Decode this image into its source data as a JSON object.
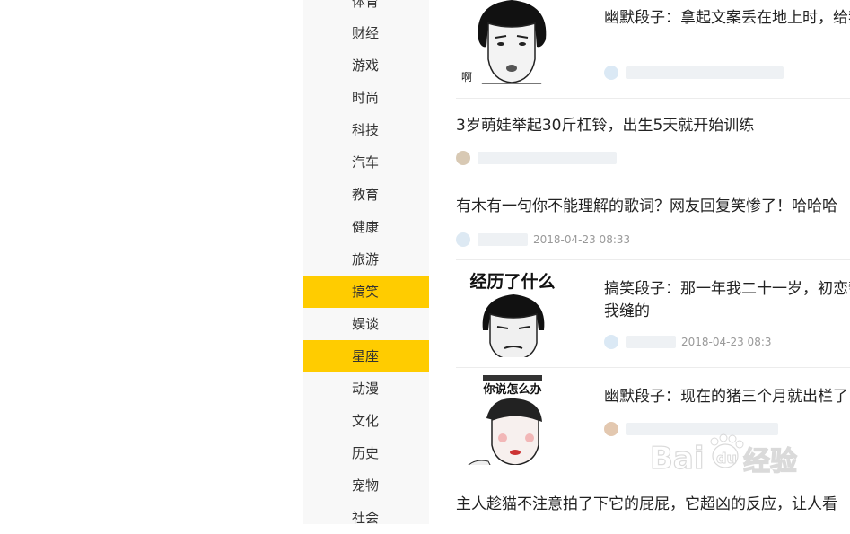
{
  "sidebar": {
    "items": [
      {
        "label": "体育",
        "active": false
      },
      {
        "label": "财经",
        "active": false
      },
      {
        "label": "游戏",
        "active": false
      },
      {
        "label": "时尚",
        "active": false
      },
      {
        "label": "科技",
        "active": false
      },
      {
        "label": "汽车",
        "active": false
      },
      {
        "label": "教育",
        "active": false
      },
      {
        "label": "健康",
        "active": false
      },
      {
        "label": "旅游",
        "active": false
      },
      {
        "label": "搞笑",
        "active": true
      },
      {
        "label": "娱谈",
        "active": false
      },
      {
        "label": "星座",
        "active": true
      },
      {
        "label": "动漫",
        "active": false
      },
      {
        "label": "文化",
        "active": false
      },
      {
        "label": "历史",
        "active": false
      },
      {
        "label": "宠物",
        "active": false
      },
      {
        "label": "社会",
        "active": false
      }
    ],
    "active_color": "#ffcc00"
  },
  "feed": {
    "articles": [
      {
        "title": "幽默段子：拿起文案丢在地上时，给我",
        "meta_text": "",
        "thumb_icon": "meme-face-icon"
      },
      {
        "title": "3岁萌娃举起30斤杠铃，出生5天就开始训练",
        "meta_text": ""
      },
      {
        "title": "有木有一句你不能理解的歌词？网友回复笑惨了！哈哈哈",
        "meta_text": "2018-04-23 08:33"
      },
      {
        "title": "搞笑段子：那一年我二十一岁，初恋帮我缝的",
        "meta_text": "2018-04-23 08:3",
        "thumb_caption": "经历了什么",
        "thumb_icon": "meme-face-icon"
      },
      {
        "title": "幽默段子：现在的猪三个月就出栏了",
        "meta_text": "",
        "thumb_caption": "你说怎么办",
        "thumb_icon": "meme-face-icon"
      },
      {
        "title": "主人趁猫不注意拍了下它的屁屁，它超凶的反应，让人看",
        "meta_text": ""
      }
    ]
  },
  "watermark": {
    "brand": "Bai",
    "brand2": "du",
    "suffix": "经验"
  }
}
